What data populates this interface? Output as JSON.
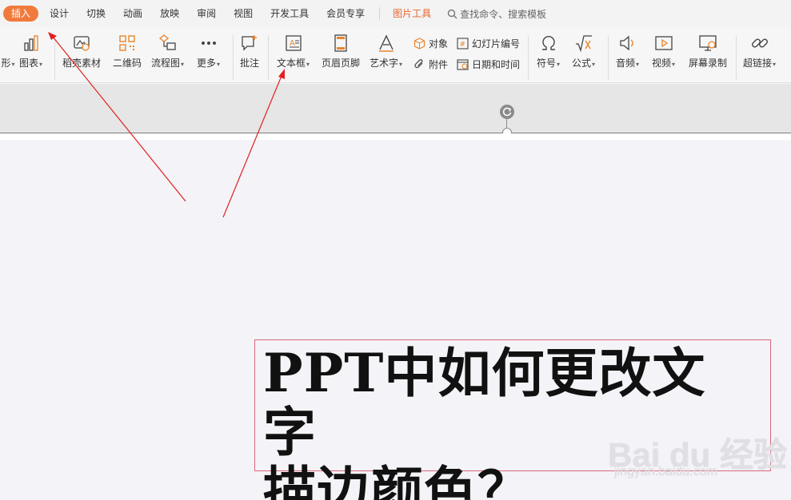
{
  "menubar": {
    "tabs": [
      {
        "label": "插入",
        "active": true
      },
      {
        "label": "设计"
      },
      {
        "label": "切换"
      },
      {
        "label": "动画"
      },
      {
        "label": "放映"
      },
      {
        "label": "审阅"
      },
      {
        "label": "视图"
      },
      {
        "label": "开发工具"
      },
      {
        "label": "会员专享"
      }
    ],
    "picture_tools": "图片工具",
    "search_placeholder": "查找命令、搜索模板"
  },
  "ribbon": {
    "shapes_partial": "形",
    "chart": "图表",
    "daoke": "稻壳素材",
    "qrcode": "二维码",
    "flowchart": "流程图",
    "more": "更多",
    "comment": "批注",
    "textbox": "文本框",
    "header_footer": "页眉页脚",
    "wordart": "艺术字",
    "object": "对象",
    "attachment": "附件",
    "slide_number": "幻灯片编号",
    "datetime": "日期和时间",
    "symbol": "符号",
    "formula": "公式",
    "audio": "音频",
    "video": "视频",
    "screen_record": "屏幕录制",
    "hyperlink": "超链接"
  },
  "slide": {
    "title_line1": "PPT中如何更改文字",
    "title_line2": "描边颜色？"
  },
  "watermark": {
    "logo": "Bai du 经验",
    "sub": "jingyan.baidu.com"
  },
  "colors": {
    "accent": "#f07a3b",
    "icon": "#444444",
    "icon_orange": "#e8862c",
    "arrow": "#e02020",
    "textbox_border": "#d9687a"
  }
}
